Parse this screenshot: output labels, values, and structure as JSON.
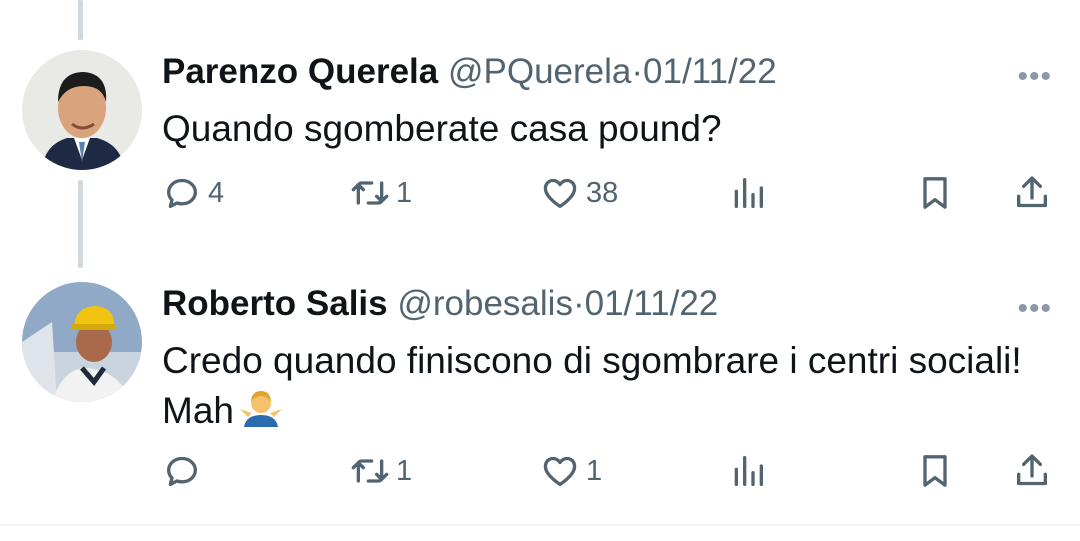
{
  "tweets": [
    {
      "name": "Parenzo Querela",
      "handle": "@PQuerela",
      "dot": "·",
      "date": "01/11/22",
      "text": "Quando sgomberate casa pound?",
      "replies": "4",
      "retweets": "1",
      "likes": "38"
    },
    {
      "name": "Roberto Salis",
      "handle": "@robesalis",
      "dot": "·",
      "date": "01/11/22",
      "text": "Credo quando finiscono di sgombrare i centri sociali! Mah",
      "emoji": "person-shrugging-emoji",
      "replies": "",
      "retweets": "1",
      "likes": "1"
    }
  ],
  "icons": {
    "more": "more-icon",
    "reply": "reply-icon",
    "retweet": "retweet-icon",
    "like": "heart-icon",
    "views": "views-icon",
    "bookmark": "bookmark-icon",
    "share": "share-icon"
  },
  "colors": {
    "text": "#0f1419",
    "secondary": "#536471",
    "thread_line": "#cfd9de"
  }
}
